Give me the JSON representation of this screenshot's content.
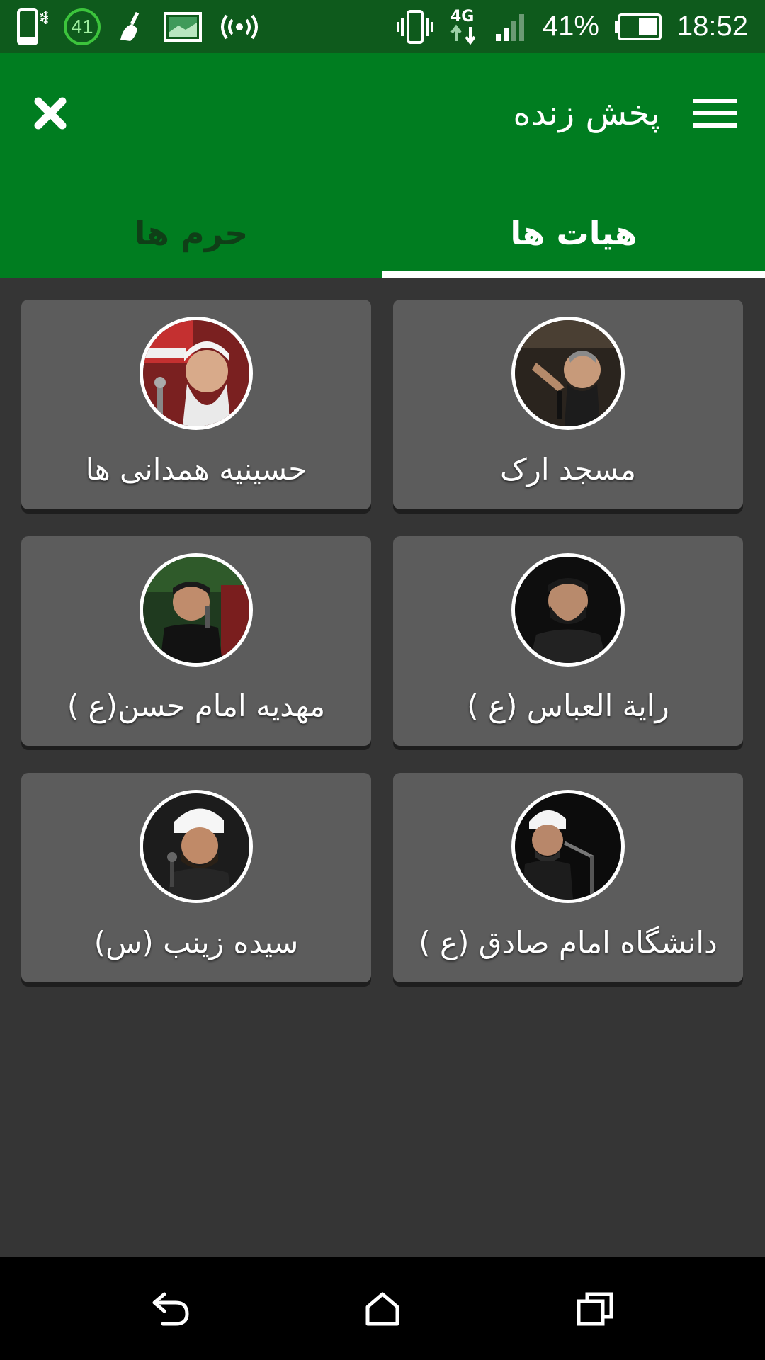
{
  "status_bar": {
    "notification_count": "41",
    "battery_percent": "41%",
    "network": "4G",
    "time": "18:52",
    "icons": [
      "phone-snowflake-icon",
      "badge-icon",
      "broom-icon",
      "image-icon",
      "hotspot-icon",
      "vibrate-icon",
      "network-4g-icon",
      "signal-icon",
      "battery-icon"
    ]
  },
  "app_bar": {
    "title": "پخش زنده",
    "close_icon": "close-icon",
    "menu_icon": "menu-icon",
    "background": "#007d20"
  },
  "tabs": [
    {
      "label": "هیات ها",
      "active": true
    },
    {
      "label": "حرم ها",
      "active": false
    }
  ],
  "items": [
    {
      "label": "مسجد ارک"
    },
    {
      "label": "حسینیه همدانی ها"
    },
    {
      "label": "راية العباس (ع )"
    },
    {
      "label": "مهدیه امام حسن(ع )"
    },
    {
      "label": "دانشگاه امام صادق (ع )"
    },
    {
      "label": "سیده زینب (س)"
    }
  ],
  "nav_bar": {
    "back_icon": "back-icon",
    "home_icon": "home-icon",
    "recents_icon": "recents-icon"
  }
}
